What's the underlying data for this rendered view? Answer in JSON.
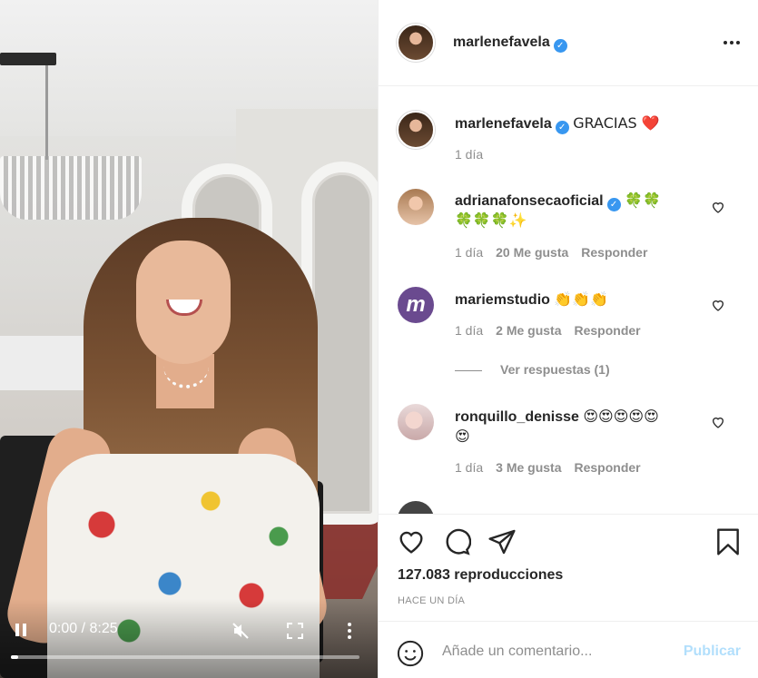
{
  "video": {
    "time": "0:00 / 8:25",
    "progress": 0.02
  },
  "post": {
    "author": "marlenefavela",
    "more_icon": "more-horizontal-icon"
  },
  "comments": [
    {
      "user": "marlenefavela",
      "verified": true,
      "text": "GRACIAS ❤️",
      "time": "1 día",
      "likes": "",
      "reply": ""
    },
    {
      "user": "adrianafonsecaoficial",
      "verified": true,
      "text": "🍀🍀",
      "text_line2": "🍀🍀🍀✨",
      "time": "1 día",
      "likes": "20 Me gusta",
      "reply": "Responder"
    },
    {
      "user": "mariemstudio",
      "verified": false,
      "text": "👏👏👏",
      "time": "1 día",
      "likes": "2 Me gusta",
      "reply": "Responder",
      "view_replies": "Ver respuestas (1)"
    },
    {
      "user": "ronquillo_denisse",
      "verified": false,
      "text": "😍😍😍😍😍",
      "text_line2": "😍",
      "time": "1 día",
      "likes": "3 Me gusta",
      "reply": "Responder"
    }
  ],
  "actions": {
    "views": "127.083 reproducciones",
    "posted_ago": "HACE UN DÍA"
  },
  "composer": {
    "placeholder": "Añade un comentario...",
    "publish_label": "Publicar"
  },
  "colors": {
    "verified": "#3897f0",
    "muted_text": "#8e8e8e",
    "publish_disabled": "#b2dffc"
  }
}
